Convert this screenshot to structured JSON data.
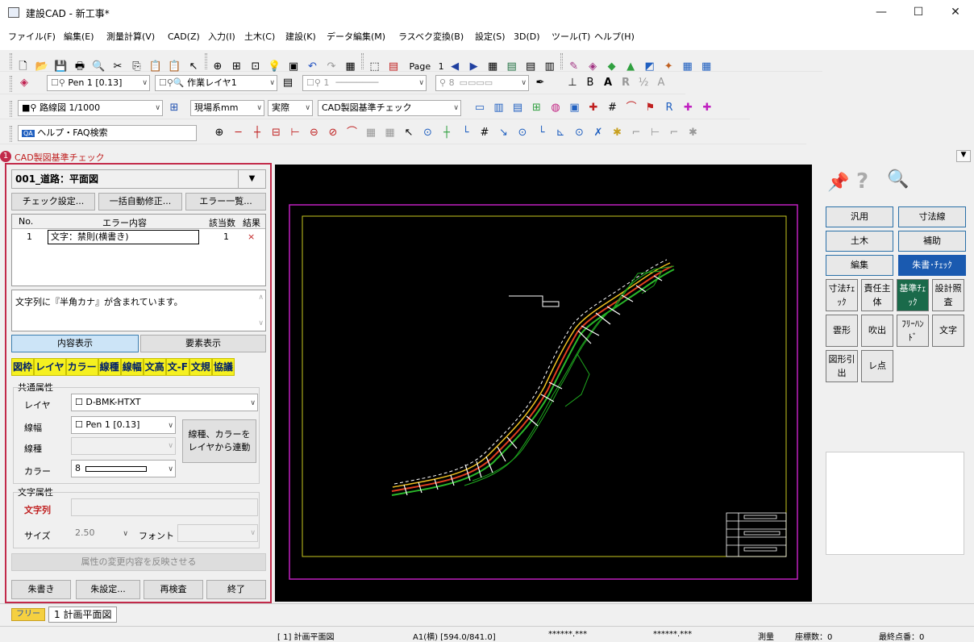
{
  "window": {
    "title": "建設CAD - 新工事*",
    "minimize": "—",
    "maximize": "☐",
    "close": "✕"
  },
  "menu": [
    "ファイル(F)",
    "編集(E)",
    "測量計算(V)",
    "CAD(Z)",
    "入力(I)",
    "土木(C)",
    "建設(K)",
    "データ編集(M)",
    "ラスベク変換(B)",
    "設定(S)",
    "3D(D)",
    "ツール(T)",
    "ヘルプ(H)"
  ],
  "toolbar1": {
    "page_label": "Page",
    "page_num": "1"
  },
  "toolbar2": {
    "pen": "Pen 1 [0.13]",
    "layer": "作業レイヤ1",
    "layer2": "1",
    "color": "8"
  },
  "toolbar3": {
    "drawing": "路線図 1/1000",
    "coord": "現場系mm",
    "scale_mode": "実際",
    "check_mode": "CAD製図基準チェック"
  },
  "toolbar4": {
    "help_search": "ヘルプ・FAQ検索"
  },
  "panel": {
    "title": "CAD製図基準チェック",
    "badge": "1",
    "drawing_select": "001_道路：平面図",
    "btn_check_settings": "チェック設定...",
    "btn_auto_fix": "一括自動修正...",
    "btn_error_list": "エラー一覧...",
    "table": {
      "headers": [
        "No.",
        "エラー内容",
        "該当数",
        "結果"
      ],
      "rows": [
        {
          "no": "1",
          "content": "文字：禁則(横書き)",
          "count": "1",
          "result": "×"
        }
      ]
    },
    "message": "文字列に『半角カナ』が含まれています。",
    "tab_content": "内容表示",
    "tab_element": "要素表示",
    "categories": [
      "図枠",
      "レイヤ",
      "カラー",
      "線種",
      "線幅",
      "文高",
      "文-F",
      "文規",
      "協議"
    ],
    "common_attr": "共通属性",
    "layer_label": "レイヤ",
    "layer_value": "D-BMK-HTXT",
    "width_label": "線幅",
    "width_value": "Pen 1   [0.13]",
    "linetype_label": "線種",
    "color_label": "カラー",
    "color_value": "8",
    "link_btn": "線種、カラーを\nレイヤから連動",
    "text_attr": "文字属性",
    "string_label": "文字列",
    "size_label": "サイズ",
    "size_value": "2.50",
    "font_label": "フォント",
    "apply_btn": "属性の変更内容を反映させる",
    "btn_redline": "朱書き",
    "btn_red_settings": "朱設定...",
    "btn_recheck": "再検査",
    "btn_exit": "終了"
  },
  "right_panel": {
    "buttons": [
      "汎用",
      "寸法線",
      "土木",
      "補助",
      "編集",
      "朱書･ﾁｪｯｸ"
    ],
    "small": [
      "寸法ﾁｪｯｸ",
      "責任主体",
      "基準ﾁｪｯｸ",
      "設計照査",
      "雲形",
      "吹出",
      "ﾌﾘｰﾊﾝﾄﾞ",
      "文字",
      "図形引出",
      "レ点"
    ]
  },
  "tabs": {
    "free": "フリー",
    "sheet": "1 計画平面図"
  },
  "status": {
    "sheet": "[ 1] 計画平面図",
    "paper": "A1(横) [594.0/841.0]",
    "x": "******.***",
    "y": "******.***",
    "mode": "測量",
    "coord_count": "座標数：0",
    "last_point": "最終点番：0"
  },
  "colors": {
    "accent_red": "#c22a4a",
    "active_teal": "#1a6a4a",
    "cad_bg": "#000000",
    "frame_magenta": "#c020c0",
    "frame_yellow": "#c8c820"
  }
}
